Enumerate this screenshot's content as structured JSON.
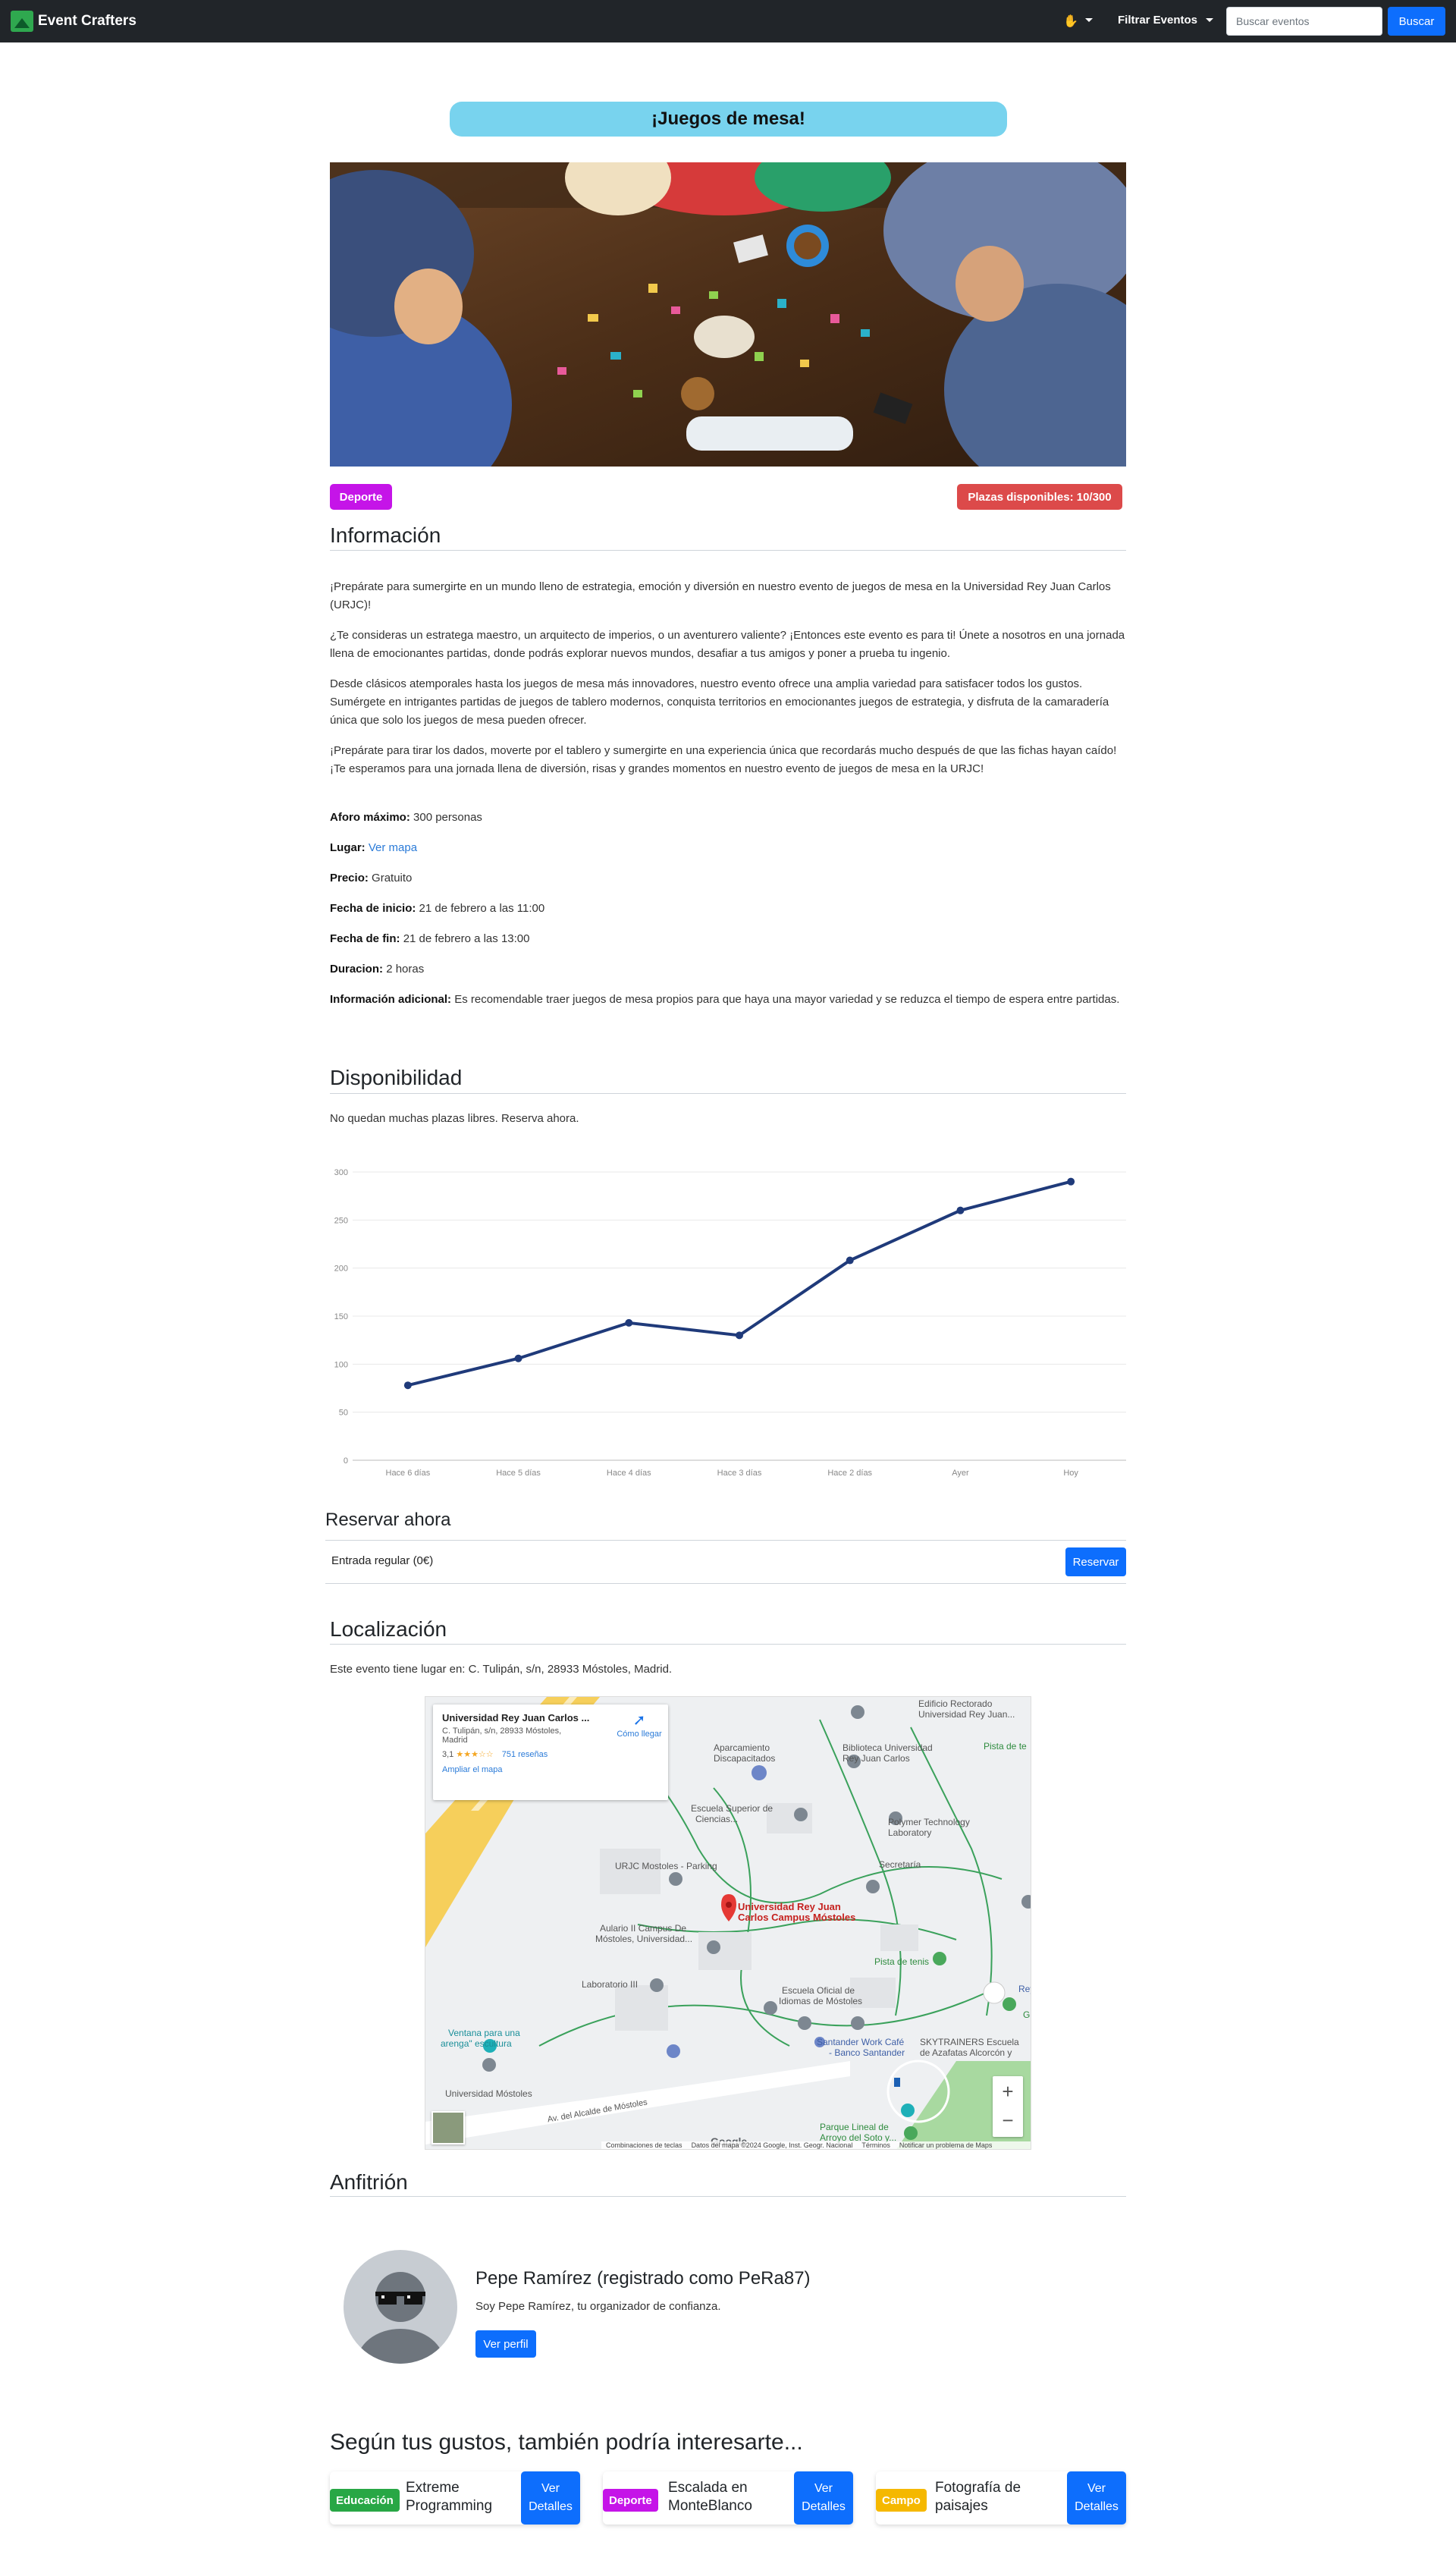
{
  "navbar": {
    "brand": "Event Crafters",
    "lang_icon": "✋",
    "filter_label": "Filtrar Eventos",
    "search_placeholder": "Buscar eventos",
    "search_button": "Buscar"
  },
  "event": {
    "title": "¡Juegos de mesa!",
    "category": "Deporte",
    "availability": "Plazas disponibles: 10/300"
  },
  "info": {
    "heading": "Información",
    "paragraphs": [
      "¡Prepárate para sumergirte en un mundo lleno de estrategia, emoción y diversión en nuestro evento de juegos de mesa en la Universidad Rey Juan Carlos (URJC)!",
      "¿Te consideras un estratega maestro, un arquitecto de imperios, o un aventurero valiente? ¡Entonces este evento es para ti! Únete a nosotros en una jornada llena de emocionantes partidas, donde podrás explorar nuevos mundos, desafiar a tus amigos y poner a prueba tu ingenio.",
      "Desde clásicos atemporales hasta los juegos de mesa más innovadores, nuestro evento ofrece una amplia variedad para satisfacer todos los gustos. Sumérgete en intrigantes partidas de juegos de tablero modernos, conquista territorios en emocionantes juegos de estrategia, y disfruta de la camaradería única que solo los juegos de mesa pueden ofrecer.",
      "¡Prepárate para tirar los dados, moverte por el tablero y sumergirte en una experiencia única que recordarás mucho después de que las fichas hayan caído! ¡Te esperamos para una jornada llena de diversión, risas y grandes momentos en nuestro evento de juegos de mesa en la URJC!"
    ],
    "details": [
      {
        "label": "Aforo máximo:",
        "value": "300 personas"
      },
      {
        "label": "Lugar:",
        "value": "Ver mapa",
        "link": true
      },
      {
        "label": "Precio:",
        "value": "Gratuito"
      },
      {
        "label": "Fecha de inicio:",
        "value": "21 de febrero a las 11:00"
      },
      {
        "label": "Fecha de fin:",
        "value": "21 de febrero a las 13:00"
      },
      {
        "label": "Duracion:",
        "value": "2 horas"
      },
      {
        "label": "Información adicional:",
        "value": "Es recomendable traer juegos de mesa propios para que haya una mayor variedad y se reduzca el tiempo de espera entre partidas."
      }
    ]
  },
  "availability_section": {
    "heading": "Disponibilidad",
    "note": "No quedan muchas plazas libres. Reserva ahora."
  },
  "chart_data": {
    "type": "line",
    "categories": [
      "Hace 6 días",
      "Hace 5 días",
      "Hace 4 días",
      "Hace 3 días",
      "Hace 2 días",
      "Ayer",
      "Hoy"
    ],
    "values": [
      78,
      106,
      143,
      130,
      208,
      260,
      290
    ],
    "ylim": [
      0,
      300
    ],
    "yticks": [
      0,
      50,
      100,
      150,
      200,
      250,
      300
    ],
    "grid": true,
    "color": "#1f3a7a"
  },
  "reservation": {
    "heading": "Reservar ahora",
    "ticket_label": "Entrada regular (0€)",
    "button": "Reservar"
  },
  "location": {
    "heading": "Localización",
    "text": "Este evento tiene lugar en: C. Tulipán, s/n, 28933 Móstoles, Madrid.",
    "map": {
      "place_name": "Universidad Rey Juan Carlos ...",
      "address_line1": "C. Tulipán, s/n, 28933 Móstoles,",
      "address_line2": "Madrid",
      "rating": "3,1",
      "stars": "★★★☆☆",
      "reviews": "751 reseñas",
      "directions": "Cómo llegar",
      "expand": "Ampliar el mapa",
      "pin_label_1": "Universidad Rey Juan",
      "pin_label_2": "Carlos Campus Móstoles",
      "labels": [
        {
          "t": "Edificio Rectorado"
        },
        {
          "t": "Universidad Rey Juan..."
        },
        {
          "t": "Aparcamiento"
        },
        {
          "t": "Discapacitados"
        },
        {
          "t": "Biblioteca Universidad"
        },
        {
          "t": "Rey Juan Carlos"
        },
        {
          "t": "Pista de te"
        },
        {
          "t": "Escuela Superior de"
        },
        {
          "t": "Ciencias..."
        },
        {
          "t": "Polymer Technology"
        },
        {
          "t": "Laboratory"
        },
        {
          "t": "URJC Mostoles - Parking"
        },
        {
          "t": "Secretaría"
        },
        {
          "t": "Aulario II Campus De"
        },
        {
          "t": "Móstoles, Universidad..."
        },
        {
          "t": "Pista de tenis"
        },
        {
          "t": "Laboratorio III"
        },
        {
          "t": "Escuela Oficial de"
        },
        {
          "t": "Idiomas de Móstoles"
        },
        {
          "t": "Ventana para una"
        },
        {
          "t": "arenga\" escultura"
        },
        {
          "t": "Santander Work Café"
        },
        {
          "t": "- Banco Santander"
        },
        {
          "t": "SKYTRAINERS Escuela"
        },
        {
          "t": "de Azafatas Alcorcón y"
        },
        {
          "t": "Universidad Móstoles"
        },
        {
          "t": "Parque Lineal de"
        },
        {
          "t": "Arroyo del Soto y..."
        },
        {
          "t": "Av. del Alcalde de Móstoles"
        },
        {
          "t": "Glor"
        },
        {
          "t": "Rey"
        }
      ],
      "footer": [
        "Combinaciones de teclas",
        "Datos del mapa ©2024 Google, Inst. Geogr. Nacional",
        "Términos",
        "Notificar un problema de Maps"
      ],
      "google": "Google",
      "zoom_in": "+",
      "zoom_out": "−"
    }
  },
  "host": {
    "heading": "Anfitrión",
    "name": "Pepe Ramírez (registrado como PeRa87)",
    "description": "Soy Pepe Ramírez, tu organizador de confianza.",
    "button": "Ver perfil"
  },
  "recommendations": {
    "heading": "Según tus gustos, también podría interesarte...",
    "items": [
      {
        "badge": "Educación",
        "badge_color": "#28a745",
        "name_line1": "Extreme",
        "name_line2": "Programming",
        "button_line1": "Ver",
        "button_line2": "Detalles"
      },
      {
        "badge": "Deporte",
        "badge_color": "#c514e8",
        "name_line1": "Escalada en",
        "name_line2": "MonteBlanco",
        "button_line1": "Ver",
        "button_line2": "Detalles"
      },
      {
        "badge": "Campo",
        "badge_color": "#f5b800",
        "name_line1": "Fotografía de",
        "name_line2": "paisajes",
        "button_line1": "Ver",
        "button_line2": "Detalles"
      }
    ]
  }
}
